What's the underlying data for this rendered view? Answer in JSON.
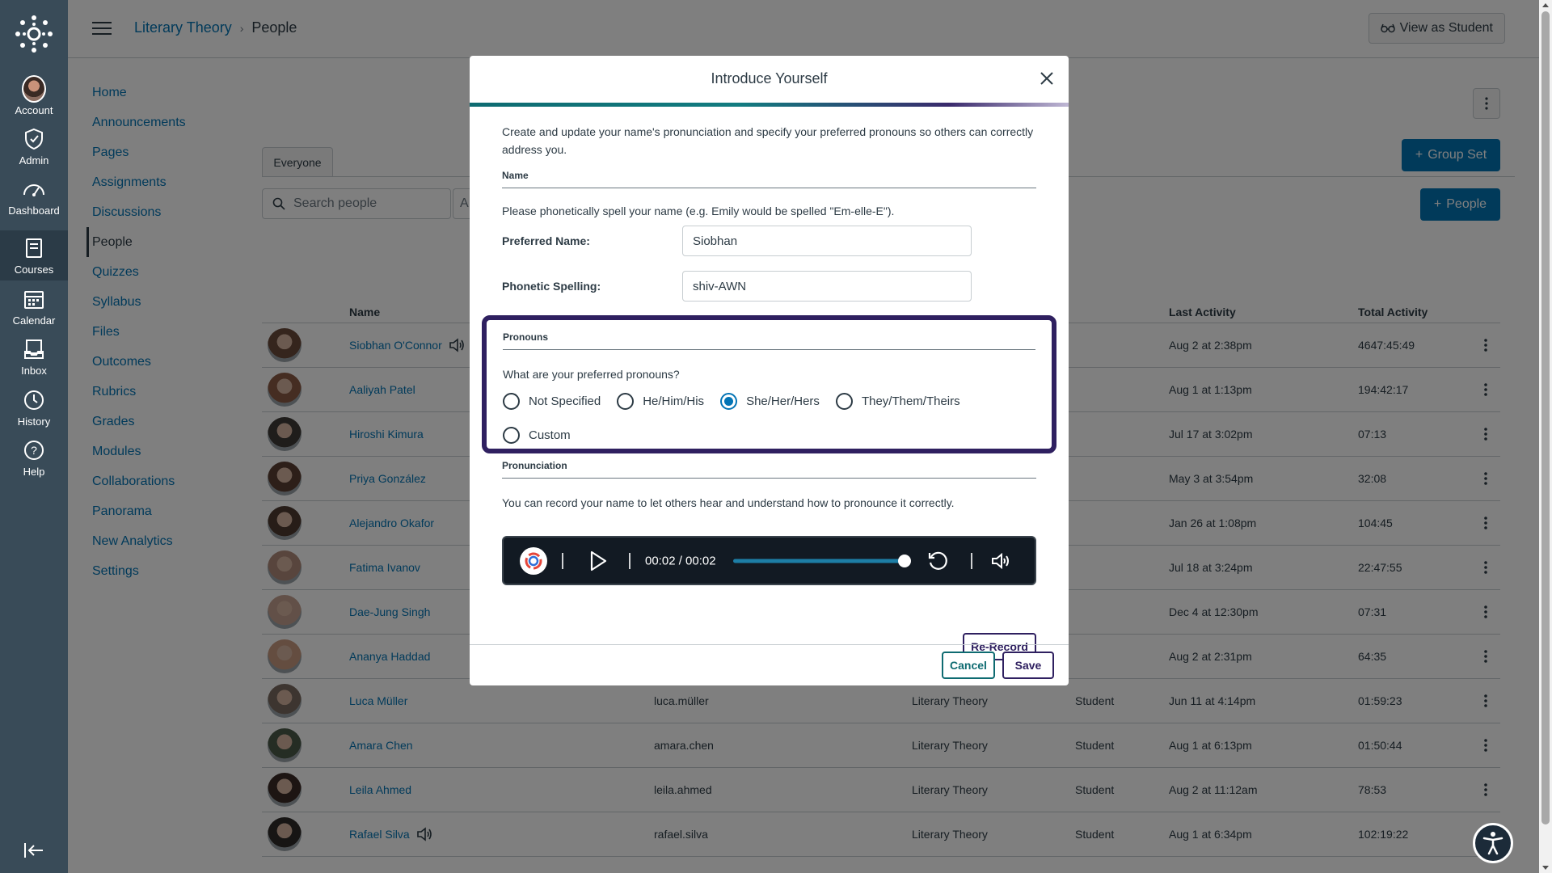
{
  "global_nav": {
    "items": [
      {
        "label": "Account",
        "icon": "avatar"
      },
      {
        "label": "Admin",
        "icon": "shield-icon"
      },
      {
        "label": "Dashboard",
        "icon": "dashboard-icon"
      },
      {
        "label": "Courses",
        "icon": "book-icon"
      },
      {
        "label": "Calendar",
        "icon": "calendar-icon"
      },
      {
        "label": "Inbox",
        "icon": "inbox-icon"
      },
      {
        "label": "History",
        "icon": "clock-icon"
      },
      {
        "label": "Help",
        "icon": "help-icon"
      }
    ]
  },
  "header": {
    "breadcrumb": [
      "Literary Theory",
      "People"
    ],
    "view_as_student": "View as Student"
  },
  "course_nav": [
    "Home",
    "Announcements",
    "Pages",
    "Assignments",
    "Discussions",
    "People",
    "Quizzes",
    "Syllabus",
    "Files",
    "Outcomes",
    "Rubrics",
    "Grades",
    "Modules",
    "Collaborations",
    "Panorama",
    "New Analytics",
    "Settings"
  ],
  "people_page": {
    "tab": "Everyone",
    "search_placeholder": "Search people",
    "role_select": "A",
    "group_set_button": "Group Set",
    "people_button": "People",
    "columns": [
      "Name",
      "Last Activity",
      "Total Activity"
    ],
    "rows": [
      {
        "name": "Siobhan O'Connor",
        "login": "",
        "course": "",
        "role": "",
        "last": "Aug 2 at 2:38pm",
        "total": "4647:45:49"
      },
      {
        "name": "Aaliyah Patel",
        "login": "",
        "course": "",
        "role": "",
        "last": "Aug 1 at 1:13pm",
        "total": "194:42:17"
      },
      {
        "name": "Hiroshi Kimura",
        "login": "",
        "course": "",
        "role": "",
        "last": "Jul 17 at 3:02pm",
        "total": "07:13"
      },
      {
        "name": "Priya González",
        "login": "",
        "course": "",
        "role": "",
        "last": "May 3 at 3:54pm",
        "total": "32:08"
      },
      {
        "name": "Alejandro Okafor",
        "login": "",
        "course": "",
        "role": "",
        "last": "Jan 26 at 1:08pm",
        "total": "104:45"
      },
      {
        "name": "Fatima Ivanov",
        "login": "",
        "course": "",
        "role": "",
        "last": "Jul 18 at 3:24pm",
        "total": "22:47:55"
      },
      {
        "name": "Dae-Jung Singh",
        "login": "",
        "course": "",
        "role": "",
        "last": "Dec 4 at 12:30pm",
        "total": "07:31"
      },
      {
        "name": "Ananya Haddad",
        "login": "",
        "course": "",
        "role": "",
        "last": "Aug 2 at 2:31pm",
        "total": "64:35"
      },
      {
        "name": "Luca Müller",
        "login": "luca.müller",
        "course": "Literary Theory",
        "role": "Student",
        "last": "Jun 11 at 4:14pm",
        "total": "01:59:23"
      },
      {
        "name": "Amara Chen",
        "login": "amara.chen",
        "course": "Literary Theory",
        "role": "Student",
        "last": "Aug 1 at 6:13pm",
        "total": "01:50:44"
      },
      {
        "name": "Leila Ahmed",
        "login": "leila.ahmed",
        "course": "Literary Theory",
        "role": "Student",
        "last": "Aug 2 at 11:12am",
        "total": "78:53"
      },
      {
        "name": "Rafael Silva",
        "login": "rafael.silva",
        "course": "Literary Theory",
        "role": "Student",
        "last": "Aug 1 at 6:34pm",
        "total": "102:19:22"
      }
    ]
  },
  "modal": {
    "title": "Introduce Yourself",
    "intro": "Create and update your name's pronunciation and specify your preferred pronouns so others can correctly address you.",
    "name_section": "Name",
    "phonetic_note": "Please phonetically spell your name (e.g. Emily would be spelled \"Em-elle-E\").",
    "preferred_name_label": "Preferred Name:",
    "preferred_name_value": "Siobhan",
    "phonetic_label": "Phonetic Spelling:",
    "phonetic_value": "shiv-AWN",
    "pronouns_section": "Pronouns",
    "pronouns_question": "What are your preferred pronouns?",
    "pronoun_options": [
      "Not Specified",
      "He/Him/His",
      "She/Her/Hers",
      "They/Them/Theirs",
      "Custom"
    ],
    "pronoun_selected": "She/Her/Hers",
    "pronunciation_section": "Pronunciation",
    "pronunciation_text": "You can record your name to let others hear and understand how to pronounce it correctly.",
    "player_time": "00:02 / 00:02",
    "player_progress": 1.0,
    "rerecord": "Re-Record",
    "cancel": "Cancel",
    "save": "Save"
  }
}
